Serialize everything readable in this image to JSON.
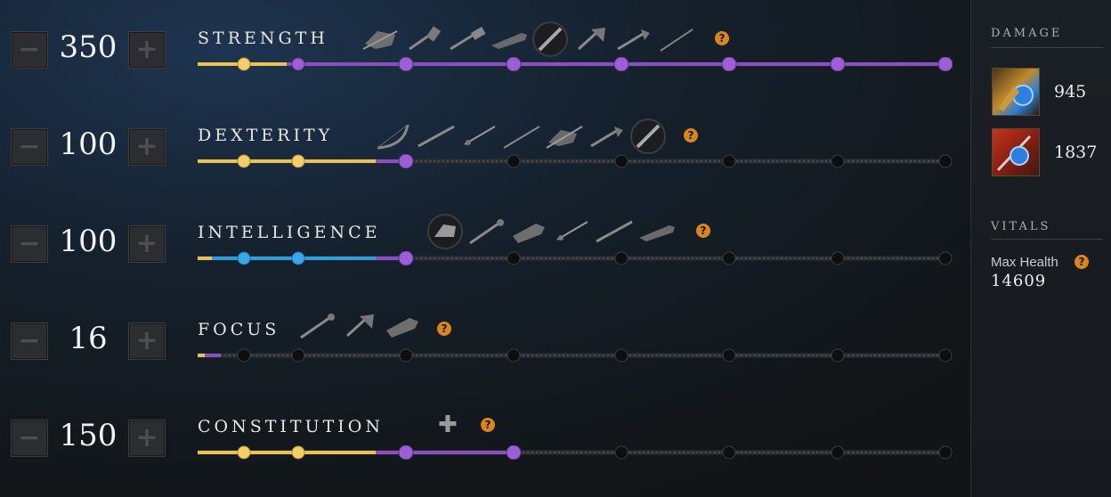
{
  "attributes": [
    {
      "name": "STRENGTH",
      "value": "350",
      "bar_color": "#8b4fc1",
      "filled_segments": 7,
      "help": "?"
    },
    {
      "name": "DEXTERITY",
      "value": "100",
      "bar_color": "#8b4fc1",
      "filled_segments": 2,
      "help": "?"
    },
    {
      "name": "INTELLIGENCE",
      "value": "100",
      "bar_color": "#2f9fdc",
      "filled_segments": 2,
      "help": "?"
    },
    {
      "name": "FOCUS",
      "value": "16",
      "bar_color": "#8b4fc1",
      "filled_segments": 0,
      "help": "?"
    },
    {
      "name": "CONSTITUTION",
      "value": "150",
      "bar_color": "#8b4fc1",
      "filled_segments": 3,
      "help": "?"
    }
  ],
  "buttons": {
    "minus": "−",
    "plus": "+"
  },
  "constitution_plus": "✚",
  "sidebar": {
    "damage_heading": "DAMAGE",
    "damage": [
      {
        "value": "945",
        "icon": "gauntlet-gem-icon"
      },
      {
        "value": "1837",
        "icon": "staff-gem-icon"
      }
    ],
    "vitals_heading": "VITALS",
    "max_health_label": "Max Health",
    "max_health_help": "?",
    "max_health_value": "14609"
  },
  "colors": {
    "gold": "#e8c35a",
    "purple": "#8b4fc1",
    "blue": "#2f9fdc",
    "help": "#d9841c"
  }
}
